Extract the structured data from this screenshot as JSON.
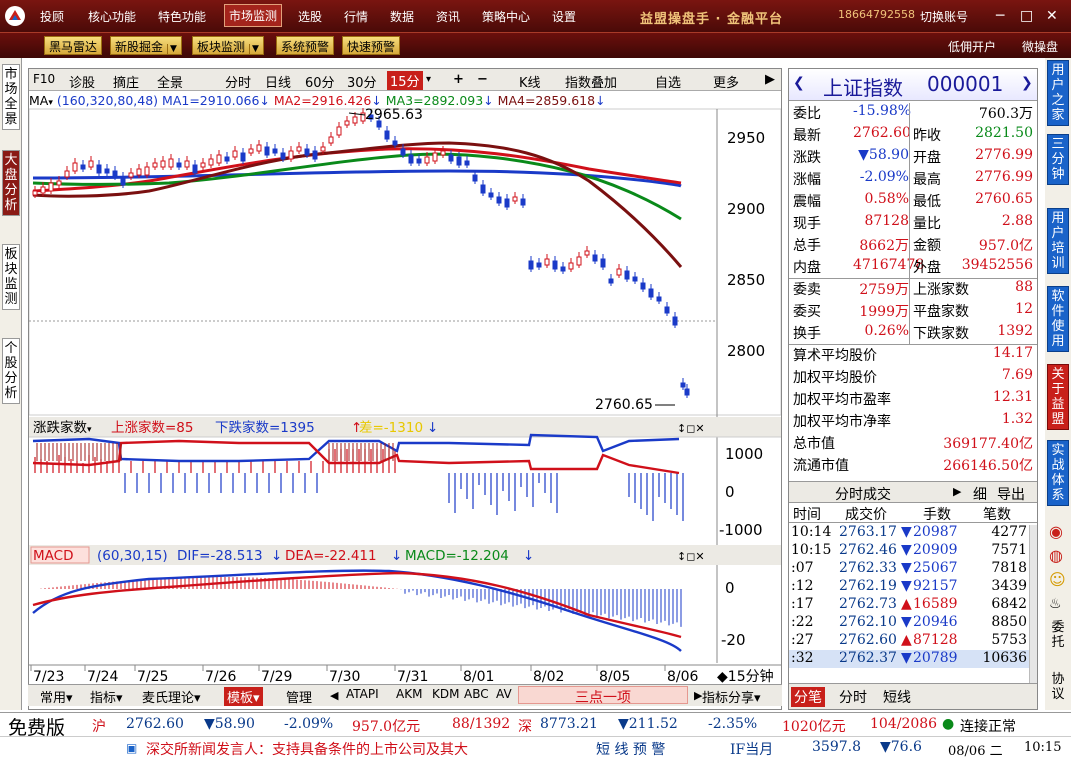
{
  "menubar": {
    "items": [
      "投顾",
      "核心功能",
      "特色功能",
      "市场监测",
      "选股",
      "行情",
      "数据",
      "资讯",
      "策略中心",
      "设置"
    ],
    "active_index": 3,
    "brand": "益盟操盘手 · 金融平台",
    "phone": "18664792558",
    "switch_account": "切换账号"
  },
  "toolbar": {
    "buttons": [
      "黑马雷达",
      "新股掘金",
      "板块监测",
      "系统预警",
      "快速预警"
    ],
    "right_links": [
      "低佣开户",
      "微操盘"
    ]
  },
  "left_tabs": [
    "市场全景",
    "大盘分析",
    "板块监测",
    "个股分析"
  ],
  "left_tabs_active": 1,
  "chart_toolbar": {
    "f10": "F10",
    "items": [
      "诊股",
      "摘庄",
      "全景"
    ],
    "periods": [
      "分时",
      "日线",
      "60分",
      "30分",
      "15分"
    ],
    "selected_period": "15分",
    "plus": "+",
    "minus": "−",
    "kline": "K线",
    "overlay": "指数叠加",
    "self_select": "自选",
    "more": "更多"
  },
  "ma_legend": {
    "label": "MA",
    "params": "(160,320,80,48)",
    "ma1": "MA1=2910.066",
    "ma2": "MA2=2916.426",
    "ma3": "MA3=2892.093",
    "ma4": "MA4=2859.618"
  },
  "price_axis": [
    "2950",
    "2900",
    "2850",
    "2800"
  ],
  "high_label": "2965.63",
  "low_label": "2760.65",
  "date_axis": [
    "7/23",
    "7/24",
    "7/25",
    "7/26",
    "7/29",
    "7/30",
    "7/31",
    "8/01",
    "8/02",
    "8/05",
    "8/06"
  ],
  "period_label": "15分钟",
  "breadth_panel": {
    "title": "涨跌家数",
    "up": "上涨家数=85",
    "down": "下跌家数=1395",
    "diff": "差=-1310",
    "axis": [
      "1000",
      "0",
      "-1000"
    ]
  },
  "macd_panel": {
    "title": "MACD",
    "params": "(60,30,15)",
    "dif": "DIF=-28.513",
    "dea": "DEA=-22.411",
    "macd": "MACD=-12.204",
    "axis": [
      "0",
      "-20"
    ]
  },
  "bottom_tabs": [
    "常用",
    "指标",
    "麦氏理论",
    "模板",
    "管理",
    "ATAPI",
    "AKM",
    "KDM",
    "ABC",
    "AV",
    "三点一项",
    "指标分享"
  ],
  "index": {
    "name": "上证指数",
    "code": "000001"
  },
  "quote": {
    "rows": [
      {
        "l1": "委比",
        "v1": "-15.98%",
        "l2": "",
        "v2": "760.3万"
      },
      {
        "l1": "最新",
        "v1": "2762.60",
        "l2": "昨收",
        "v2": "2821.50"
      },
      {
        "l1": "涨跌",
        "v1": "▼58.90",
        "l2": "开盘",
        "v2": "2776.99"
      },
      {
        "l1": "涨幅",
        "v1": "-2.09%",
        "l2": "最高",
        "v2": "2776.99"
      },
      {
        "l1": "震幅",
        "v1": "0.58%",
        "l2": "最低",
        "v2": "2760.65"
      },
      {
        "l1": "现手",
        "v1": "87128",
        "l2": "量比",
        "v2": "2.88"
      },
      {
        "l1": "总手",
        "v1": "8662万",
        "l2": "金额",
        "v2": "957.0亿"
      },
      {
        "l1": "内盘",
        "v1": "47167478",
        "l2": "外盘",
        "v2": "39452556"
      },
      {
        "l1": "委卖",
        "v1": "2759万",
        "l2": "上涨家数",
        "v2": "88"
      },
      {
        "l1": "委买",
        "v1": "1999万",
        "l2": "平盘家数",
        "v2": "12"
      },
      {
        "l1": "换手",
        "v1": "0.26%",
        "l2": "下跌家数",
        "v2": "1392"
      }
    ],
    "stats": [
      {
        "l": "算术平均股价",
        "v": "14.17"
      },
      {
        "l": "加权平均股价",
        "v": "7.69"
      },
      {
        "l": "加权平均市盈率",
        "v": "12.31"
      },
      {
        "l": "加权平均市净率",
        "v": "1.32"
      },
      {
        "l": "总市值",
        "v": "369177.40亿"
      },
      {
        "l": "流通市值",
        "v": "266146.50亿"
      }
    ]
  },
  "ticks": {
    "title": "分时成交",
    "detail": "细",
    "export": "导出",
    "headers": [
      "时间",
      "成交价",
      "手数",
      "笔数"
    ],
    "rows": [
      {
        "t": "10:14",
        "p": "2763.17",
        "d": "▼",
        "q": "20987",
        "n": "4277"
      },
      {
        "t": "10:15",
        "p": "2762.46",
        "d": "▼",
        "q": "20909",
        "n": "7571"
      },
      {
        "t": ":07",
        "p": "2762.33",
        "d": "▼",
        "q": "25067",
        "n": "7818"
      },
      {
        "t": ":12",
        "p": "2762.19",
        "d": "▼",
        "q": "92157",
        "n": "3439"
      },
      {
        "t": ":17",
        "p": "2762.73",
        "d": "▲",
        "q": "16589",
        "n": "6842"
      },
      {
        "t": ":22",
        "p": "2762.10",
        "d": "▼",
        "q": "20946",
        "n": "8850"
      },
      {
        "t": ":27",
        "p": "2762.60",
        "d": "▲",
        "q": "87128",
        "n": "5753"
      },
      {
        "t": ":32",
        "p": "2762.37",
        "d": "▼",
        "q": "20789",
        "n": "10636"
      }
    ],
    "tabs": [
      "分笔",
      "分时",
      "短线"
    ]
  },
  "right_side": [
    "用户之家",
    "三分钟",
    "用户培训",
    "软件使用",
    "关于益盟",
    "实战体系",
    "委托",
    "协议"
  ],
  "status": {
    "free": "免费版",
    "sh_label": "沪",
    "sh_price": "2762.60",
    "sh_change": "▼58.90",
    "sh_pct": "-2.09%",
    "sh_amount": "957.0亿元",
    "sh_breadth": "88/1392",
    "sz_label": "深",
    "sz_price": "8773.21",
    "sz_change": "▼211.52",
    "sz_pct": "-2.35%",
    "sz_amount": "1020亿元",
    "sz_breadth": "104/2086",
    "conn": "连接正常",
    "news": "深交所新闻发言人：支持具备条件的上市公司及其大",
    "alert": "短 线 预 警",
    "if_label": "IF当月",
    "if_price": "3597.8",
    "if_change": "▼76.6",
    "date": "08/06 二",
    "time": "10:15"
  },
  "colors": {
    "ma1": "#1a3ac8",
    "ma2": "#d0101a",
    "ma3": "#0a8a1a",
    "ma4": "#7a1010",
    "up": "#d0101a",
    "down": "#1a3ac8"
  }
}
